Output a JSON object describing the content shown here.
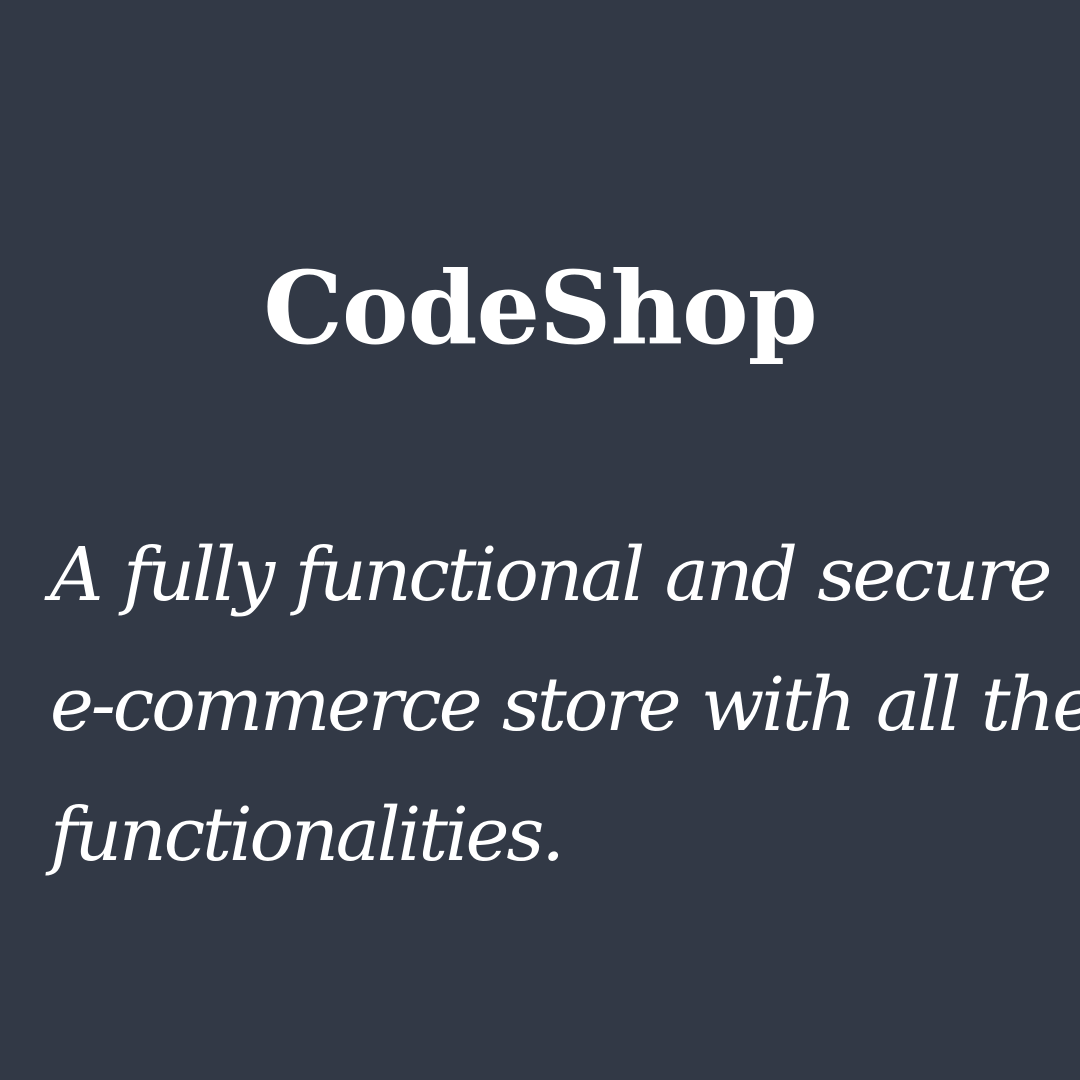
{
  "card": {
    "background": "#323946",
    "text_color": "#ffffff",
    "title": "CodeShop",
    "tagline_lines": [
      "A fully functional and secure",
      "e-commerce store with all the",
      "functionalities."
    ]
  }
}
